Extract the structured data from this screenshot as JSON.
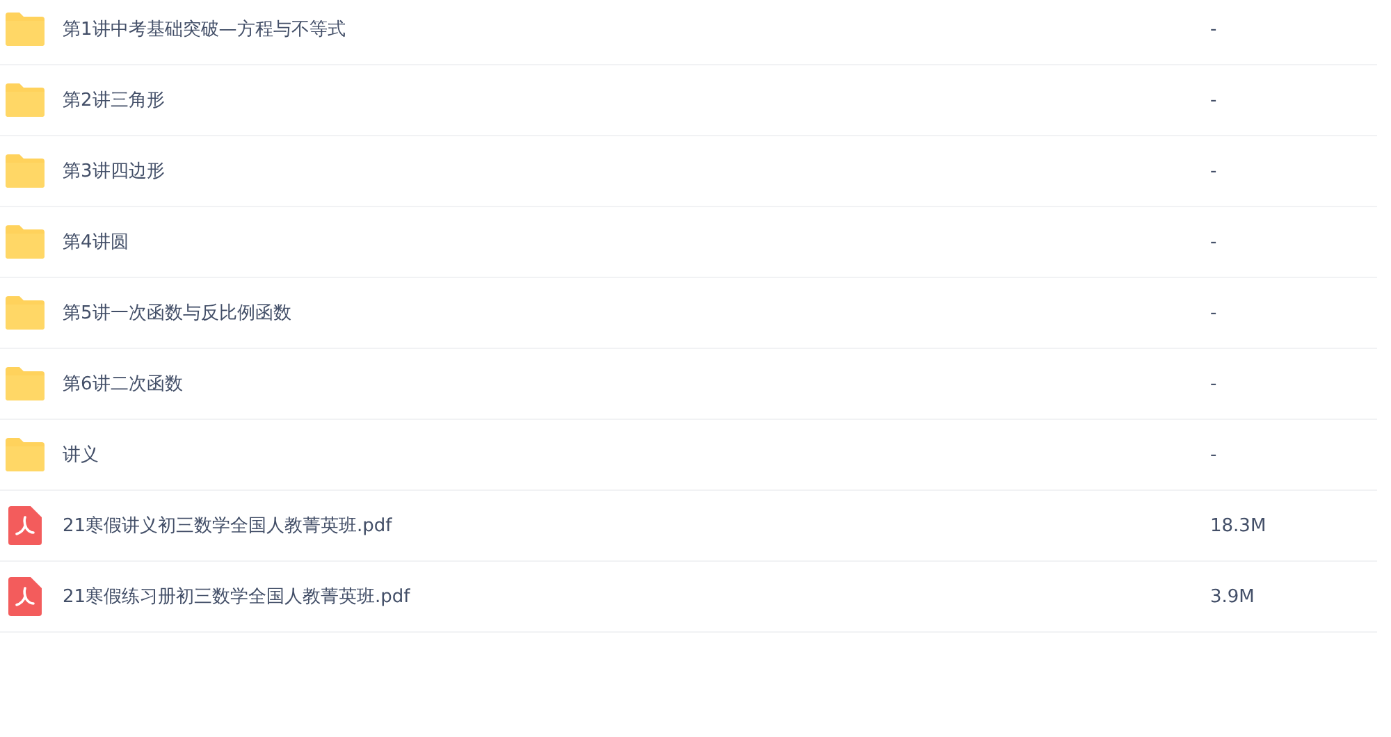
{
  "files": [
    {
      "kind": "folder",
      "name": "第1讲中考基础突破—方程与不等式",
      "size": "-"
    },
    {
      "kind": "folder",
      "name": "第2讲三角形",
      "size": "-"
    },
    {
      "kind": "folder",
      "name": "第3讲四边形",
      "size": "-"
    },
    {
      "kind": "folder",
      "name": "第4讲圆",
      "size": "-"
    },
    {
      "kind": "folder",
      "name": "第5讲一次函数与反比例函数",
      "size": "-"
    },
    {
      "kind": "folder",
      "name": "第6讲二次函数",
      "size": "-"
    },
    {
      "kind": "folder",
      "name": "讲义",
      "size": "-"
    },
    {
      "kind": "pdf",
      "name": "21寒假讲义初三数学全国人教菁英班.pdf",
      "size": "18.3M"
    },
    {
      "kind": "pdf",
      "name": "21寒假练习册初三数学全国人教菁英班.pdf",
      "size": "3.9M"
    }
  ]
}
